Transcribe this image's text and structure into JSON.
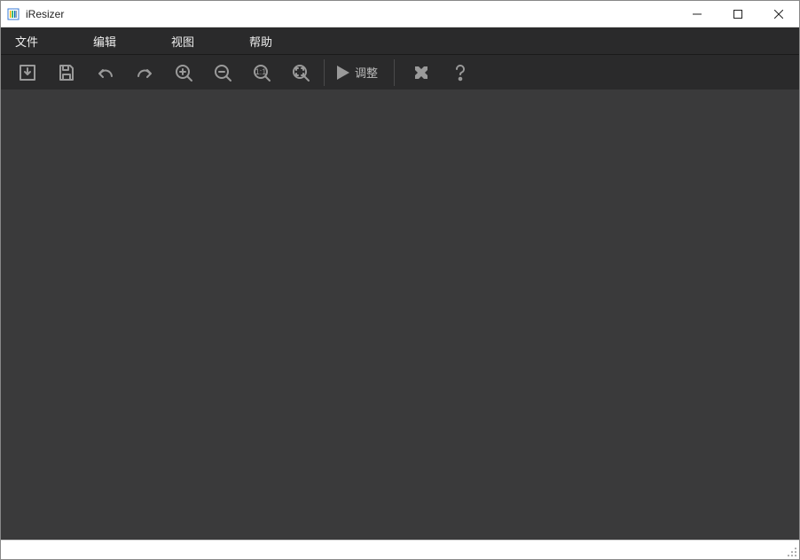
{
  "window": {
    "title": "iResizer"
  },
  "menubar": {
    "items": [
      "文件",
      "编辑",
      "视图",
      "帮助"
    ]
  },
  "toolbar": {
    "run_label": "调整"
  }
}
